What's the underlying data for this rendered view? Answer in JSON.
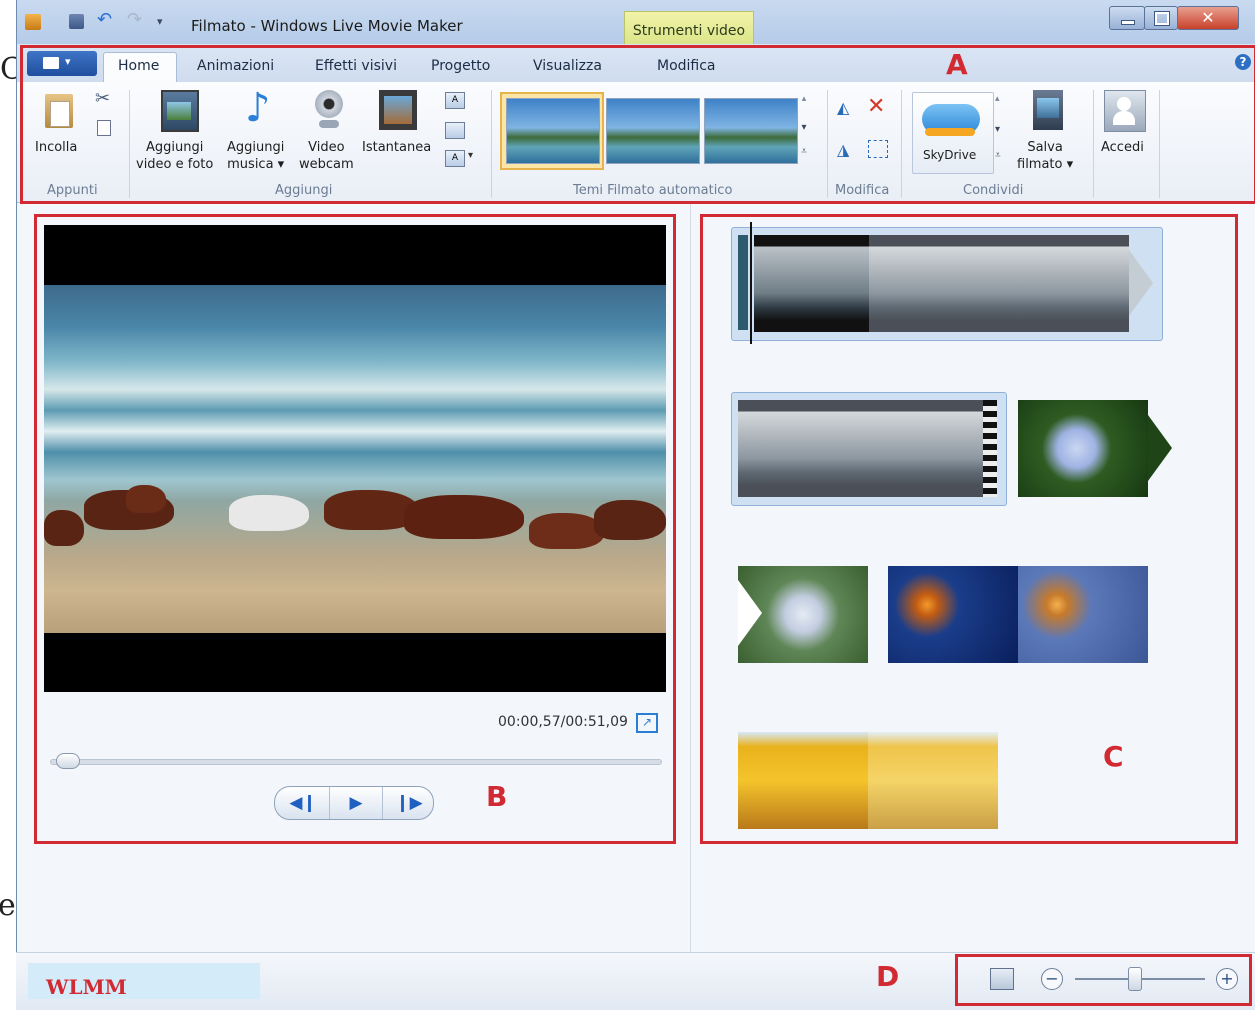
{
  "window": {
    "title": "Filmato - Windows Live Movie Maker",
    "contextual_tab": "Strumenti video"
  },
  "edge_letters": {
    "top": "C",
    "bottom": "e"
  },
  "ribbon_tabs": [
    "Home",
    "Animazioni",
    "Effetti visivi",
    "Progetto",
    "Visualizza",
    "Modifica"
  ],
  "ribbon": {
    "paste_label": "Incolla",
    "add_video_label_1": "Aggiungi",
    "add_video_label_2": "video e foto",
    "add_music_label_1": "Aggiungi",
    "add_music_label_2": "musica ▾",
    "webcam_label_1": "Video",
    "webcam_label_2": "webcam",
    "snapshot_label": "Istantanea",
    "skydrive_label": "SkyDrive",
    "save_label_1": "Salva",
    "save_label_2": "filmato ▾",
    "signin_label": "Accedi",
    "groups": {
      "appunti": "Appunti",
      "aggiungi": "Aggiungi",
      "temi": "Temi Filmato automatico",
      "modifica": "Modifica",
      "condividi": "Condividi"
    }
  },
  "annotations": {
    "a": "A",
    "b": "B",
    "c": "C",
    "d": "D"
  },
  "player": {
    "timecode": "00:00,57/00:51,09",
    "progress_fraction": 0.011
  },
  "footer": {
    "badge": "WLMM"
  },
  "zoom": {
    "level_fraction": 0.45
  },
  "icons": [
    "file-menu-icon",
    "save-icon",
    "undo-icon",
    "redo-icon",
    "help-icon",
    "fullscreen-icon"
  ],
  "colors": {
    "annotation": "#d22a32",
    "accent": "#1f5fbf"
  }
}
